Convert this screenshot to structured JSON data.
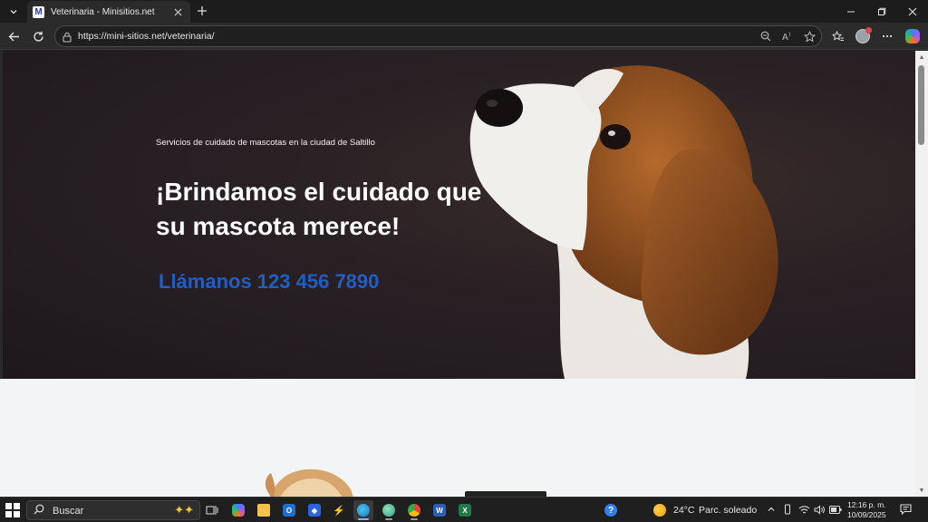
{
  "browser": {
    "tab_title": "Veterinaria - Minisitios.net",
    "tab_favicon_letter": "M",
    "url": "https://mini-sitios.net/veterinaria/"
  },
  "hero": {
    "subtitle": "Servicios de cuidado de mascotas en la ciudad de Saltillo",
    "title": "¡Brindamos el cuidado que su mascota merece!",
    "phone": "Llámanos 123 456 7890",
    "phone_color": "#1f5fc4"
  },
  "taskbar": {
    "search_placeholder": "Buscar",
    "weather_temp": "24°C",
    "weather_desc": "Parc. soleado",
    "time": "12:16 p. m.",
    "date": "10/09/2025"
  },
  "icons": {
    "tab_menu": "chevron-down-icon",
    "close": "close-icon",
    "new_tab": "plus-icon",
    "back": "arrow-left-icon",
    "reload": "reload-icon",
    "lock": "lock-icon",
    "zoom": "zoom-out-icon",
    "read_aloud": "read-aloud-icon",
    "favorite": "star-icon",
    "favorites": "favorites-icon",
    "more": "ellipsis-icon"
  }
}
